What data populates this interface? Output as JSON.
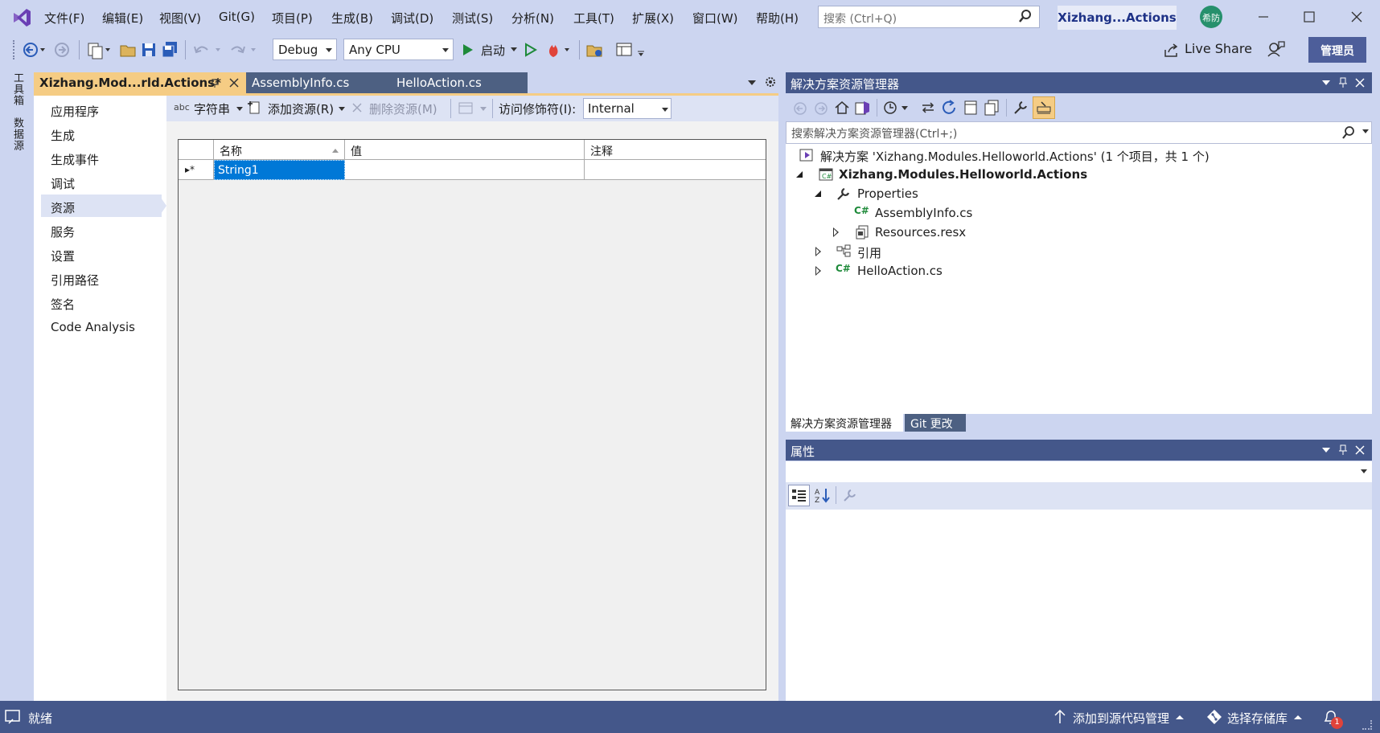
{
  "menu": [
    "文件(F)",
    "编辑(E)",
    "视图(V)",
    "Git(G)",
    "项目(P)",
    "生成(B)",
    "调试(D)",
    "测试(S)",
    "分析(N)",
    "工具(T)",
    "扩展(X)",
    "窗口(W)",
    "帮助(H)"
  ],
  "search": {
    "placeholder": "搜索 (Ctrl+Q)"
  },
  "window_title": "Xizhang...Actions",
  "avatar_text": "希防",
  "toolbar": {
    "config": "Debug",
    "platform": "Any CPU",
    "start_label": "启动",
    "live_share": "Live Share",
    "admin": "管理员"
  },
  "side_tabs": [
    "工具箱",
    "数据源"
  ],
  "doc_tabs": [
    {
      "label": "Xizhang.Mod...rld.Actions*",
      "active": true
    },
    {
      "label": "AssemblyInfo.cs",
      "active": false
    },
    {
      "label": "HelloAction.cs",
      "active": false
    }
  ],
  "nav": {
    "items": [
      "应用程序",
      "生成",
      "生成事件",
      "调试",
      "资源",
      "服务",
      "设置",
      "引用路径",
      "签名",
      "Code Analysis"
    ],
    "selected": "资源"
  },
  "resource_toolbar": {
    "type": "字符串",
    "add": "添加资源(R)",
    "remove": "删除资源(M)",
    "access_label": "访问修饰符(I):",
    "access_value": "Internal"
  },
  "grid": {
    "headers": [
      "名称",
      "值",
      "注释"
    ],
    "rows": [
      {
        "marker": "▸*",
        "name": "String1",
        "value": "",
        "comment": ""
      }
    ]
  },
  "solution_explorer": {
    "title": "解决方案资源管理器",
    "search_placeholder": "搜索解决方案资源管理器(Ctrl+;)",
    "solution": "解决方案 'Xizhang.Modules.Helloworld.Actions' (1 个项目，共 1 个)",
    "project": "Xizhang.Modules.Helloworld.Actions",
    "properties": "Properties",
    "assemblyinfo": "AssemblyInfo.cs",
    "resources": "Resources.resx",
    "references": "引用",
    "helloaction": "HelloAction.cs",
    "tabs": [
      "解决方案资源管理器",
      "Git 更改"
    ]
  },
  "properties_panel": {
    "title": "属性"
  },
  "status": {
    "ready": "就绪",
    "source_control": "添加到源代码管理",
    "repo": "选择存储库",
    "notifications": "1"
  },
  "colors": {
    "accent": "#f5cc84",
    "panel_title": "#44578a",
    "selection": "#0078d7",
    "vs_purple": "#6a3fb4"
  }
}
